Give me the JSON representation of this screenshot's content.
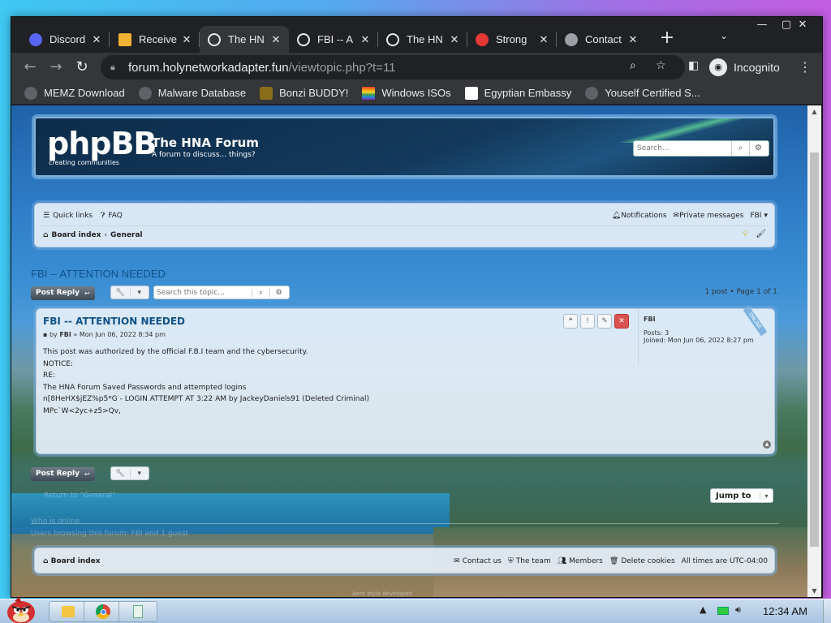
{
  "browser": {
    "tabs": [
      {
        "title": "Discord",
        "icon": "discord-icon",
        "color": "#5865f2",
        "active": false
      },
      {
        "title": "Receive",
        "icon": "folder-icon",
        "color": "#f2b233",
        "active": false
      },
      {
        "title": "The HN",
        "icon": "globe-icon",
        "color": "#e8eaed",
        "active": true
      },
      {
        "title": "FBI -- A",
        "icon": "globe-icon",
        "color": "#e8eaed",
        "active": false
      },
      {
        "title": "The HN",
        "icon": "globe-icon",
        "color": "#e8eaed",
        "active": false
      },
      {
        "title": "Strong",
        "icon": "strong-icon",
        "color": "#e53935",
        "active": false
      },
      {
        "title": "Contact",
        "icon": "contact-icon",
        "color": "#9aa0a6",
        "active": false
      }
    ],
    "url_host": "forum.holynetworkadapter.fun",
    "url_path": "/viewtopic.php?t=11",
    "profile_label": "Incognito",
    "bookmarks": [
      {
        "label": "MEMZ Download",
        "color": "#5f6368"
      },
      {
        "label": "Malware Database",
        "color": "#5f6368"
      },
      {
        "label": "Bonzi BUDDY!",
        "color": "#8a6d1a"
      },
      {
        "label": "Windows ISOs",
        "color": "#e040a0"
      },
      {
        "label": "Egyptian Embassy",
        "color": "#ffffff"
      },
      {
        "label": "Youself Certified S...",
        "color": "#5f6368"
      }
    ]
  },
  "forum": {
    "logo_text": "phpBB",
    "logo_tagline": "creating communities",
    "site_title": "The HNA Forum",
    "site_desc": "A forum to discuss... things?",
    "search_placeholder": "Search...",
    "nav": {
      "quick_links": "Quick links",
      "faq": "FAQ",
      "notifications": "Notifications",
      "private_messages": "Private messages",
      "user": "FBI",
      "board_index": "Board index",
      "breadcrumb_sep": "‹",
      "breadcrumb_forum": "General"
    },
    "topic_title": "FBI -- ATTENTION NEEDED",
    "post_reply": "Post Reply",
    "topic_search_placeholder": "Search this topic...",
    "pagination": "1 post • Page 1 of 1",
    "post": {
      "title": "FBI -- ATTENTION NEEDED",
      "meta_by": "by",
      "author": "FBI",
      "date": "» Mon Jun 06, 2022 8:34 pm",
      "lines": [
        "This post was authorized by the official F.B.I team and the cybersecurity.",
        "",
        "NOTICE:",
        "RE:",
        "",
        "The HNA Forum Saved Passwords and attempted logins",
        "n[8HeHX$jEZ%p5*G - LOGIN ATTEMPT AT 3:22 AM by JackeyDaniels91 (Deleted Criminal)",
        "MPc`W<2yc+z5>Qv,"
      ],
      "profile_name": "FBI",
      "posts_label": "Posts: 3",
      "joined_label": "Joined: Mon Jun 06, 2022 8:27 pm",
      "online_badge": "ONLINE"
    },
    "jump_to": "Jump to",
    "return_link": "Return to \"General\"",
    "who_online_title": "Who is online",
    "who_online_text": "Users browsing this forum: FBI and 1 guest",
    "footer": {
      "board_index": "Board index",
      "contact": "Contact us",
      "team": "The team",
      "members": "Members",
      "delete_cookies": "Delete cookies",
      "timezone": "All times are UTC-04:00"
    },
    "credit": "Aero style developed"
  },
  "taskbar": {
    "clock": "12:34 AM"
  }
}
